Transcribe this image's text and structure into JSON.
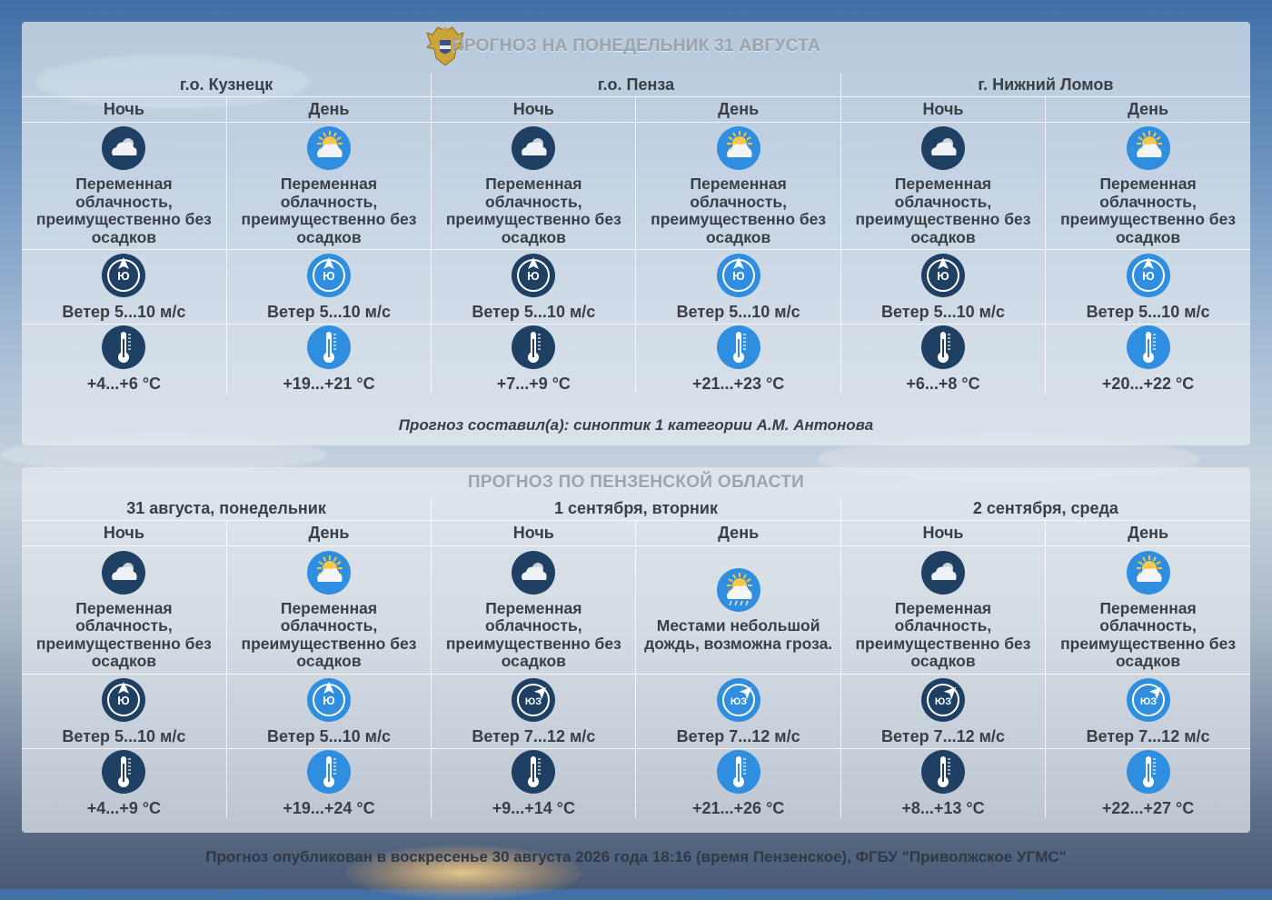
{
  "colors": {
    "night_icon": "#1f3f63",
    "day_icon": "#2f8ee0",
    "panel": "rgba(228,234,240,0.72)",
    "title": "#9ba3ad"
  },
  "panel1": {
    "title": "ПРОГНОЗ НА ПОНЕДЕЛЬНИК 31 АВГУСТА",
    "emblem_icon": "eagle-emblem-icon",
    "locations": [
      "г.о. Кузнецк",
      "г.о. Пенза",
      "г. Нижний Ломов"
    ],
    "parts": [
      "Ночь",
      "День",
      "Ночь",
      "День",
      "Ночь",
      "День"
    ],
    "weather": [
      {
        "icon": "night-cloud-icon",
        "text": "Переменная облачность, преимущественно без осадков"
      },
      {
        "icon": "sun-cloud-icon",
        "text": "Переменная облачность, преимущественно без осадков"
      },
      {
        "icon": "night-cloud-icon",
        "text": "Переменная облачность, преимущественно без осадков"
      },
      {
        "icon": "sun-cloud-icon",
        "text": "Переменная облачность, преимущественно без осадков"
      },
      {
        "icon": "night-cloud-icon",
        "text": "Переменная облачность, преимущественно без осадков"
      },
      {
        "icon": "sun-cloud-icon",
        "text": "Переменная облачность, преимущественно без осадков"
      }
    ],
    "wind": [
      {
        "dir": "Ю",
        "text": "Ветер 5...10 м/с"
      },
      {
        "dir": "Ю",
        "text": "Ветер 5...10 м/с"
      },
      {
        "dir": "Ю",
        "text": "Ветер 5...10 м/с"
      },
      {
        "dir": "Ю",
        "text": "Ветер 5...10 м/с"
      },
      {
        "dir": "Ю",
        "text": "Ветер 5...10 м/с"
      },
      {
        "dir": "Ю",
        "text": "Ветер 5...10 м/с"
      }
    ],
    "temps": [
      "+4...+6 °C",
      "+19...+21 °C",
      "+7...+9 °C",
      "+21...+23 °C",
      "+6...+8 °C",
      "+20...+22 °C"
    ],
    "author": "Прогноз составил(а): синоптик 1 категории А.М. Антонова"
  },
  "panel2": {
    "title": "ПРОГНОЗ ПО ПЕНЗЕНСКОЙ ОБЛАСТИ",
    "dates": [
      "31 августа, понедельник",
      "1 сентября, вторник",
      "2 сентября, среда"
    ],
    "parts": [
      "Ночь",
      "День",
      "Ночь",
      "День",
      "Ночь",
      "День"
    ],
    "weather": [
      {
        "icon": "night-cloud-icon",
        "text": "Переменная облачность, преимущественно без осадков"
      },
      {
        "icon": "sun-cloud-icon",
        "text": "Переменная облачность, преимущественно без осадков"
      },
      {
        "icon": "night-cloud-icon",
        "text": "Переменная облачность, преимущественно без осадков"
      },
      {
        "icon": "sun-cloud-rain-icon",
        "text": "Местами небольшой дождь, возможна гроза."
      },
      {
        "icon": "night-cloud-icon",
        "text": "Переменная облачность, преимущественно без осадков"
      },
      {
        "icon": "sun-cloud-icon",
        "text": "Переменная облачность, преимущественно без осадков"
      }
    ],
    "wind": [
      {
        "dir": "Ю",
        "text": "Ветер 5...10 м/с"
      },
      {
        "dir": "Ю",
        "text": "Ветер 5...10 м/с"
      },
      {
        "dir": "ЮЗ",
        "text": "Ветер 7...12 м/с"
      },
      {
        "dir": "ЮЗ",
        "text": "Ветер 7...12 м/с"
      },
      {
        "dir": "ЮЗ",
        "text": "Ветер 7...12 м/с"
      },
      {
        "dir": "ЮЗ",
        "text": "Ветер 7...12 м/с"
      }
    ],
    "temps": [
      "+4...+9 °C",
      "+19...+24 °C",
      "+9...+14 °C",
      "+21...+26 °C",
      "+8...+13 °C",
      "+22...+27 °C"
    ]
  },
  "footer": "Прогноз опубликован в воскресенье 30 августа 2026 года 18:16 (время Пензенское), ФГБУ \"Приволжское УГМС\""
}
